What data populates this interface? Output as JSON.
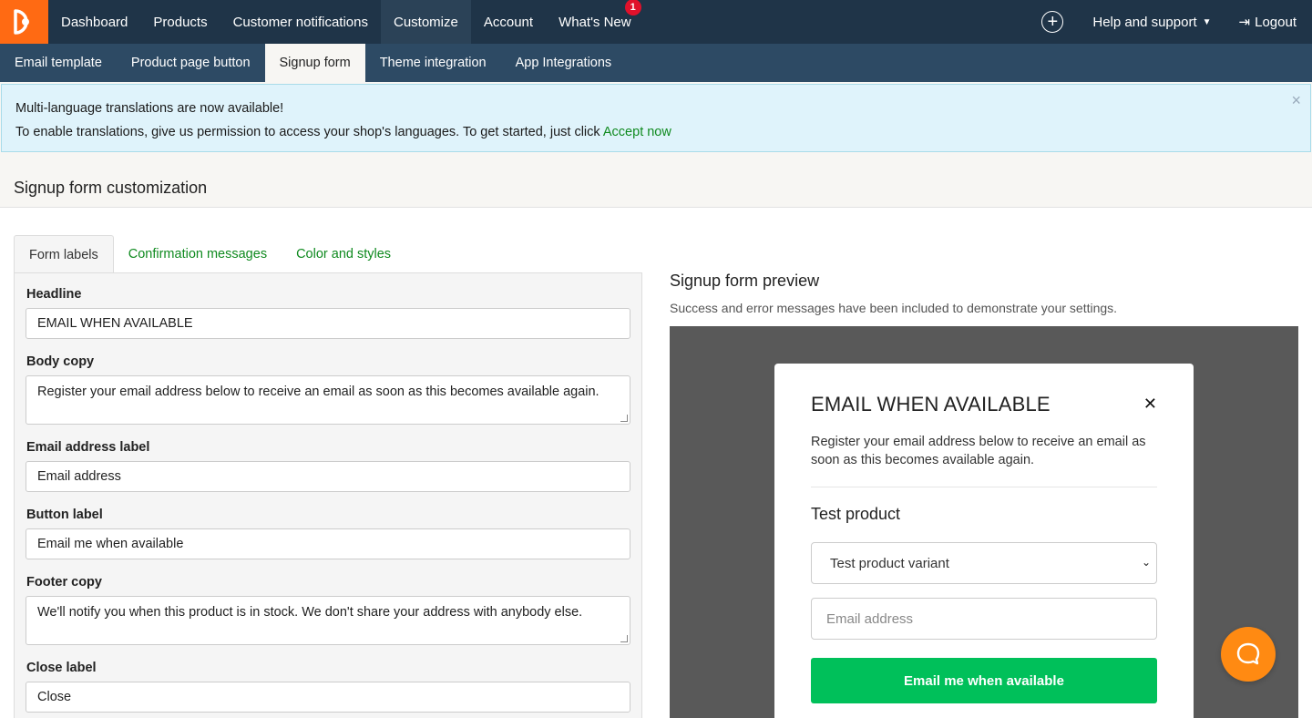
{
  "topnav": {
    "items": [
      {
        "label": "Dashboard"
      },
      {
        "label": "Products"
      },
      {
        "label": "Customer notifications"
      },
      {
        "label": "Customize"
      },
      {
        "label": "Account"
      },
      {
        "label": "What's New",
        "badge": "1"
      }
    ],
    "active": "Customize",
    "help_label": "Help and support",
    "logout_label": "Logout"
  },
  "subnav": {
    "items": [
      {
        "label": "Email template"
      },
      {
        "label": "Product page button"
      },
      {
        "label": "Signup form"
      },
      {
        "label": "Theme integration"
      },
      {
        "label": "App Integrations"
      }
    ],
    "active": "Signup form"
  },
  "alert": {
    "title": "Multi-language translations are now available!",
    "body": "To enable translations, give us permission to access your shop's languages. To get started, just click",
    "link": "Accept now",
    "close": "×"
  },
  "page": {
    "heading": "Signup form customization"
  },
  "tabs": [
    {
      "label": "Form labels"
    },
    {
      "label": "Confirmation messages"
    },
    {
      "label": "Color and styles"
    }
  ],
  "form": {
    "headline_label": "Headline",
    "headline_value": "EMAIL WHEN AVAILABLE",
    "body_label": "Body copy",
    "body_value": "Register your email address below to receive an email as soon as this becomes available again.",
    "email_label": "Email address label",
    "email_value": "Email address",
    "button_label": "Button label",
    "button_value": "Email me when available",
    "footer_label": "Footer copy",
    "footer_value": "We'll notify you when this product is in stock. We don't share your address with anybody else.",
    "close_label": "Close label",
    "close_value": "Close"
  },
  "preview": {
    "title": "Signup form preview",
    "subtitle": "Success and error messages have been included to demonstrate your settings.",
    "modal": {
      "headline": "EMAIL WHEN AVAILABLE",
      "close": "✕",
      "body": "Register your email address below to receive an email as soon as this becomes available again.",
      "product": "Test product",
      "variant": "Test product variant",
      "email_placeholder": "Email address",
      "button": "Email me when available"
    }
  },
  "colors": {
    "nav_bg": "#1f3448",
    "subnav_bg": "#2d4a64",
    "brand_orange": "#ff6a13",
    "link_green": "#0f8a1f",
    "button_green": "#00c05a",
    "chat_orange": "#ff8a12"
  },
  "icons": [
    "logo-icon",
    "plus-circle-icon",
    "caret-down-icon",
    "logout-icon",
    "close-icon",
    "chevron-down-icon",
    "chat-icon"
  ]
}
